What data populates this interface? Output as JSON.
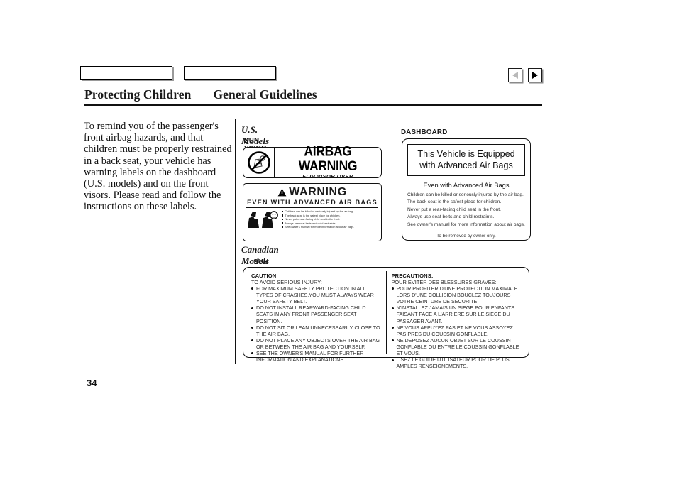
{
  "header": {
    "tabs": [
      "",
      ""
    ],
    "title_left": "Protecting Children",
    "title_right": "General Guidelines",
    "nav": {
      "prev_label": "◀",
      "next_label": "▶"
    }
  },
  "body": {
    "intro": "To remind you of the passenger's front airbag hazards, and that children must be properly restrained in a back seat, your vehicle has warning labels on the dashboard (U.S. models) and on the front visors. Please read and follow the instructions on these labels."
  },
  "figures": {
    "us": {
      "section_label": "U.S. Models",
      "sun_visor_label": "SUN VISOR",
      "dashboard_label": "DASHBOARD",
      "visor_label_1": {
        "headline": "AIRBAG WARNING",
        "subline": "FLIP VISOR OVER"
      },
      "visor_label_2": {
        "headline": "WARNING",
        "subhead": "EVEN WITH ADVANCED AIR BAGS",
        "bullets": [
          "Children can be killed or seriously injured by the air bag.",
          "The back seat is the safest place for children.",
          "Never put a rear-facing child seat in the front.",
          "Always use seat belts and child restraints.",
          "See owner's manual for more information about air bags."
        ]
      },
      "dashboard_label_content": {
        "headline": "This Vehicle is Equipped with Advanced Air Bags",
        "subhead": "Even with Advanced Air Bags",
        "lines": [
          "Children can be killed or seriously injured by the air bag.",
          "The back seat is the safest place for children.",
          "Never put a rear-facing child seat in the front.",
          "Always use seat belts and child restraints.",
          "See owner's manual for more information about air bags."
        ],
        "footer": "To be removed by owner only."
      }
    },
    "canadian": {
      "section_label": "Canadian Models",
      "sun_visor_label": "SUN VISOR",
      "english": {
        "title": "CAUTION",
        "lead": "TO AVOID SERIOUS INJURY:",
        "bullets": [
          "FOR MAXIMUM SAFETY PROTECTION IN ALL TYPES OF CRASHES,YOU MUST ALWAYS WEAR YOUR SAFETY BELT.",
          "DO NOT INSTALL REARWARD-FACING CHILD SEATS IN ANY FRONT PASSENGER SEAT POSITION.",
          "DO NOT SIT OR LEAN UNNECESSARILY CLOSE TO THE AIR BAG.",
          "DO NOT PLACE ANY OBJECTS OVER THE AIR BAG OR BETWEEN THE AIR BAG AND YOURSELF.",
          "SEE THE OWNER'S MANUAL FOR FURTHER INFORMATION AND EXPLANATIONS."
        ]
      },
      "french": {
        "title": "PRECAUTIONS:",
        "lead": "POUR EVITER DES BLESSURES GRAVES:",
        "bullets": [
          "POUR PROFITER D'UNE PROTECTION MAXIMALE LORS D'UNE COLLISION BOUCLEZ TOUJOURS VOTRE CEINTURE DE SECURITE.",
          "N'INSTALLEZ JAMAIS UN SIEGE POUR ENFANTS FAISANT FACE A L'ARRIERE SUR LE SIEGE DU PASSAGER AVANT.",
          "NE VOUS APPUYEZ PAS ET NE VOUS ASSOYEZ PAS PRES DU COUSSIN GONFLABLE.",
          "NE DEPOSEZ AUCUN OBJET SUR LE COUSSIN GONFLABLE OU ENTRE LE COUSSIN GONFLABLE ET VOUS.",
          "LISEZ LE GUIDE UTILISATEUR POUR DE PLUS AMPLES RENSEIGNEMENTS."
        ]
      }
    }
  },
  "footer": {
    "page_number": "34"
  }
}
